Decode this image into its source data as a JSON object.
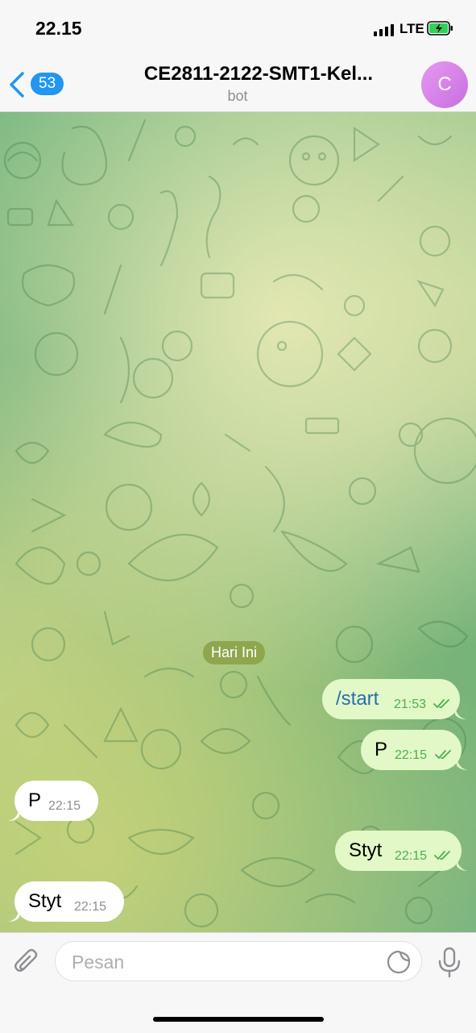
{
  "status_bar": {
    "time": "22.15",
    "network": "LTE"
  },
  "header": {
    "back_badge": "53",
    "title": "CE2811-2122-SMT1-Kel...",
    "subtitle": "bot",
    "avatar_letter": "C"
  },
  "chat": {
    "date_label": "Hari Ini",
    "messages": [
      {
        "direction": "outgoing",
        "text": "/start",
        "time": "21:53",
        "status": "read"
      },
      {
        "direction": "outgoing",
        "text": "P",
        "time": "22:15",
        "status": "read"
      },
      {
        "direction": "incoming",
        "text": "P",
        "time": "22:15"
      },
      {
        "direction": "outgoing",
        "text": "Styt",
        "time": "22:15",
        "status": "read"
      },
      {
        "direction": "incoming",
        "text": "Styt",
        "time": "22:15"
      }
    ]
  },
  "input": {
    "placeholder": "Pesan"
  },
  "icons": {
    "back": "chevron-left-icon",
    "attach": "paperclip-icon",
    "sticker": "sticker-icon",
    "mic": "microphone-icon",
    "ticks": "double-check-icon"
  },
  "colors": {
    "accent": "#2196f3",
    "outgoing_bubble": "#e2f8c6",
    "incoming_bubble": "#ffffff",
    "date_pill": "#8fa64e",
    "read_ticks": "#4caf50"
  }
}
